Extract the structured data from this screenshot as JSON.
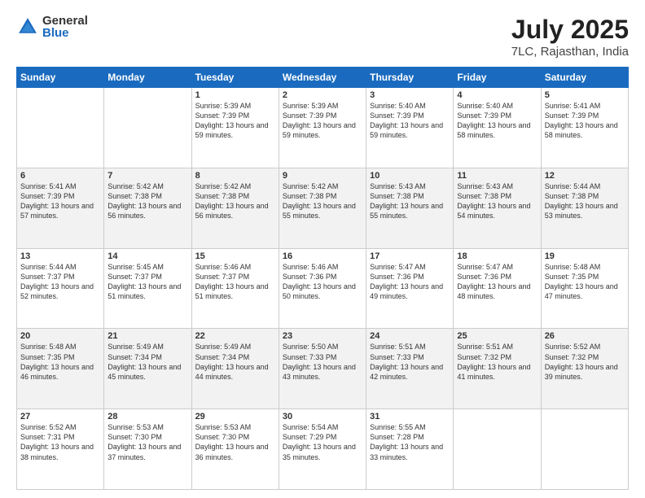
{
  "logo": {
    "general": "General",
    "blue": "Blue"
  },
  "title": "July 2025",
  "subtitle": "7LC, Rajasthan, India",
  "days_of_week": [
    "Sunday",
    "Monday",
    "Tuesday",
    "Wednesday",
    "Thursday",
    "Friday",
    "Saturday"
  ],
  "weeks": [
    [
      {
        "day": "",
        "info": ""
      },
      {
        "day": "",
        "info": ""
      },
      {
        "day": "1",
        "info": "Sunrise: 5:39 AM\nSunset: 7:39 PM\nDaylight: 13 hours and 59 minutes."
      },
      {
        "day": "2",
        "info": "Sunrise: 5:39 AM\nSunset: 7:39 PM\nDaylight: 13 hours and 59 minutes."
      },
      {
        "day": "3",
        "info": "Sunrise: 5:40 AM\nSunset: 7:39 PM\nDaylight: 13 hours and 59 minutes."
      },
      {
        "day": "4",
        "info": "Sunrise: 5:40 AM\nSunset: 7:39 PM\nDaylight: 13 hours and 58 minutes."
      },
      {
        "day": "5",
        "info": "Sunrise: 5:41 AM\nSunset: 7:39 PM\nDaylight: 13 hours and 58 minutes."
      }
    ],
    [
      {
        "day": "6",
        "info": "Sunrise: 5:41 AM\nSunset: 7:39 PM\nDaylight: 13 hours and 57 minutes."
      },
      {
        "day": "7",
        "info": "Sunrise: 5:42 AM\nSunset: 7:38 PM\nDaylight: 13 hours and 56 minutes."
      },
      {
        "day": "8",
        "info": "Sunrise: 5:42 AM\nSunset: 7:38 PM\nDaylight: 13 hours and 56 minutes."
      },
      {
        "day": "9",
        "info": "Sunrise: 5:42 AM\nSunset: 7:38 PM\nDaylight: 13 hours and 55 minutes."
      },
      {
        "day": "10",
        "info": "Sunrise: 5:43 AM\nSunset: 7:38 PM\nDaylight: 13 hours and 55 minutes."
      },
      {
        "day": "11",
        "info": "Sunrise: 5:43 AM\nSunset: 7:38 PM\nDaylight: 13 hours and 54 minutes."
      },
      {
        "day": "12",
        "info": "Sunrise: 5:44 AM\nSunset: 7:38 PM\nDaylight: 13 hours and 53 minutes."
      }
    ],
    [
      {
        "day": "13",
        "info": "Sunrise: 5:44 AM\nSunset: 7:37 PM\nDaylight: 13 hours and 52 minutes."
      },
      {
        "day": "14",
        "info": "Sunrise: 5:45 AM\nSunset: 7:37 PM\nDaylight: 13 hours and 51 minutes."
      },
      {
        "day": "15",
        "info": "Sunrise: 5:46 AM\nSunset: 7:37 PM\nDaylight: 13 hours and 51 minutes."
      },
      {
        "day": "16",
        "info": "Sunrise: 5:46 AM\nSunset: 7:36 PM\nDaylight: 13 hours and 50 minutes."
      },
      {
        "day": "17",
        "info": "Sunrise: 5:47 AM\nSunset: 7:36 PM\nDaylight: 13 hours and 49 minutes."
      },
      {
        "day": "18",
        "info": "Sunrise: 5:47 AM\nSunset: 7:36 PM\nDaylight: 13 hours and 48 minutes."
      },
      {
        "day": "19",
        "info": "Sunrise: 5:48 AM\nSunset: 7:35 PM\nDaylight: 13 hours and 47 minutes."
      }
    ],
    [
      {
        "day": "20",
        "info": "Sunrise: 5:48 AM\nSunset: 7:35 PM\nDaylight: 13 hours and 46 minutes."
      },
      {
        "day": "21",
        "info": "Sunrise: 5:49 AM\nSunset: 7:34 PM\nDaylight: 13 hours and 45 minutes."
      },
      {
        "day": "22",
        "info": "Sunrise: 5:49 AM\nSunset: 7:34 PM\nDaylight: 13 hours and 44 minutes."
      },
      {
        "day": "23",
        "info": "Sunrise: 5:50 AM\nSunset: 7:33 PM\nDaylight: 13 hours and 43 minutes."
      },
      {
        "day": "24",
        "info": "Sunrise: 5:51 AM\nSunset: 7:33 PM\nDaylight: 13 hours and 42 minutes."
      },
      {
        "day": "25",
        "info": "Sunrise: 5:51 AM\nSunset: 7:32 PM\nDaylight: 13 hours and 41 minutes."
      },
      {
        "day": "26",
        "info": "Sunrise: 5:52 AM\nSunset: 7:32 PM\nDaylight: 13 hours and 39 minutes."
      }
    ],
    [
      {
        "day": "27",
        "info": "Sunrise: 5:52 AM\nSunset: 7:31 PM\nDaylight: 13 hours and 38 minutes."
      },
      {
        "day": "28",
        "info": "Sunrise: 5:53 AM\nSunset: 7:30 PM\nDaylight: 13 hours and 37 minutes."
      },
      {
        "day": "29",
        "info": "Sunrise: 5:53 AM\nSunset: 7:30 PM\nDaylight: 13 hours and 36 minutes."
      },
      {
        "day": "30",
        "info": "Sunrise: 5:54 AM\nSunset: 7:29 PM\nDaylight: 13 hours and 35 minutes."
      },
      {
        "day": "31",
        "info": "Sunrise: 5:55 AM\nSunset: 7:28 PM\nDaylight: 13 hours and 33 minutes."
      },
      {
        "day": "",
        "info": ""
      },
      {
        "day": "",
        "info": ""
      }
    ]
  ]
}
